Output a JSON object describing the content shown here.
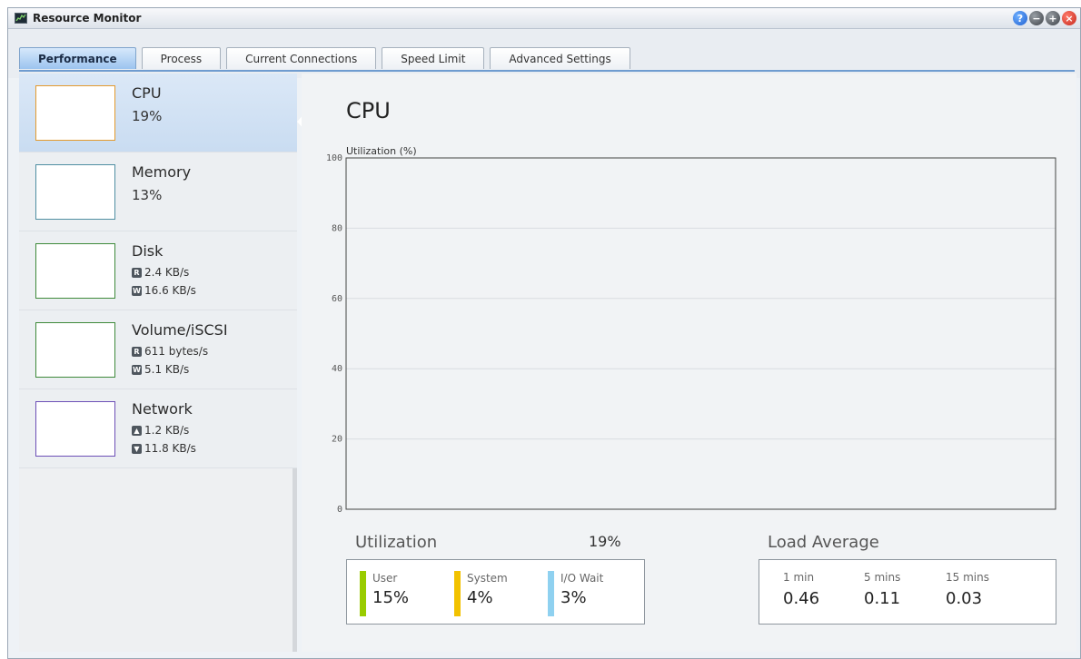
{
  "window": {
    "title": "Resource Monitor"
  },
  "window_buttons": [
    "help",
    "minimize",
    "maximize",
    "close"
  ],
  "tabs": [
    {
      "label": "Performance",
      "active": true
    },
    {
      "label": "Process",
      "active": false
    },
    {
      "label": "Current Connections",
      "active": false
    },
    {
      "label": "Speed Limit",
      "active": false
    },
    {
      "label": "Advanced Settings",
      "active": false
    }
  ],
  "sidebar": {
    "items": [
      {
        "title": "CPU",
        "value": "19%",
        "thumb_color": "#e39a2d"
      },
      {
        "title": "Memory",
        "value": "13%",
        "thumb_color": "#4f8ea2"
      },
      {
        "title": "Disk",
        "read_badge": "R",
        "read": "2.4 KB/s",
        "write_badge": "W",
        "write": "16.6 KB/s",
        "thumb_color": "#3e8a3a"
      },
      {
        "title": "Volume/iSCSI",
        "read_badge": "R",
        "read": "611 bytes/s",
        "write_badge": "W",
        "write": "5.1 KB/s",
        "thumb_color": "#3e8a3a"
      },
      {
        "title": "Network",
        "up": "1.2 KB/s",
        "down": "11.8 KB/s",
        "thumb_color": "#6c4fb6"
      }
    ]
  },
  "main": {
    "title": "CPU",
    "utilization_heading": "Utilization",
    "utilization_total": "19%",
    "load_heading": "Load Average",
    "utilization": [
      {
        "label": "User",
        "value": "15%",
        "color": "#99cc00"
      },
      {
        "label": "System",
        "value": "4%",
        "color": "#f2c200"
      },
      {
        "label": "I/O Wait",
        "value": "3%",
        "color": "#8fd1f0"
      }
    ],
    "load": [
      {
        "label": "1 min",
        "value": "0.46"
      },
      {
        "label": "5 mins",
        "value": "0.11"
      },
      {
        "label": "15 mins",
        "value": "0.03"
      }
    ]
  },
  "chart_data": {
    "type": "line",
    "ylabel": "Utilization (%)",
    "ylim": [
      0,
      100
    ],
    "yticks": [
      0,
      20,
      40,
      60,
      80,
      100
    ],
    "grid": true,
    "series": []
  }
}
